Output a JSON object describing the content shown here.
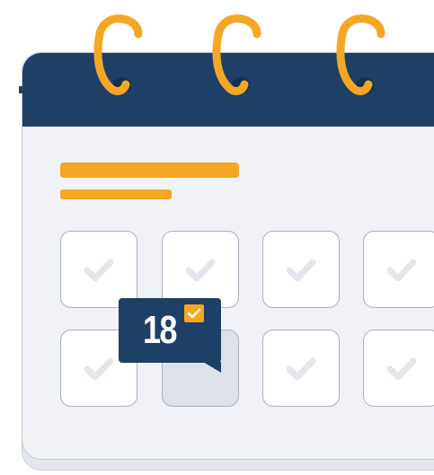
{
  "calendar": {
    "selected_day": "18",
    "icons": {
      "ring": "binder-ring-icon",
      "day_check": "checkmark-icon",
      "badge_check": "check-badge-icon"
    },
    "cells": [
      {
        "row": 1,
        "col": 1,
        "checked": true,
        "selected": false
      },
      {
        "row": 1,
        "col": 2,
        "checked": true,
        "selected": false
      },
      {
        "row": 1,
        "col": 3,
        "checked": true,
        "selected": false
      },
      {
        "row": 1,
        "col": 4,
        "checked": true,
        "selected": false
      },
      {
        "row": 2,
        "col": 1,
        "checked": true,
        "selected": false
      },
      {
        "row": 2,
        "col": 2,
        "checked": false,
        "selected": true
      },
      {
        "row": 2,
        "col": 3,
        "checked": true,
        "selected": false
      },
      {
        "row": 2,
        "col": 4,
        "checked": true,
        "selected": false
      }
    ]
  },
  "colors": {
    "navy": "#1e3f66",
    "orange": "#f5a623",
    "page": "#f0f2f7",
    "check": "#e3e6ec"
  }
}
